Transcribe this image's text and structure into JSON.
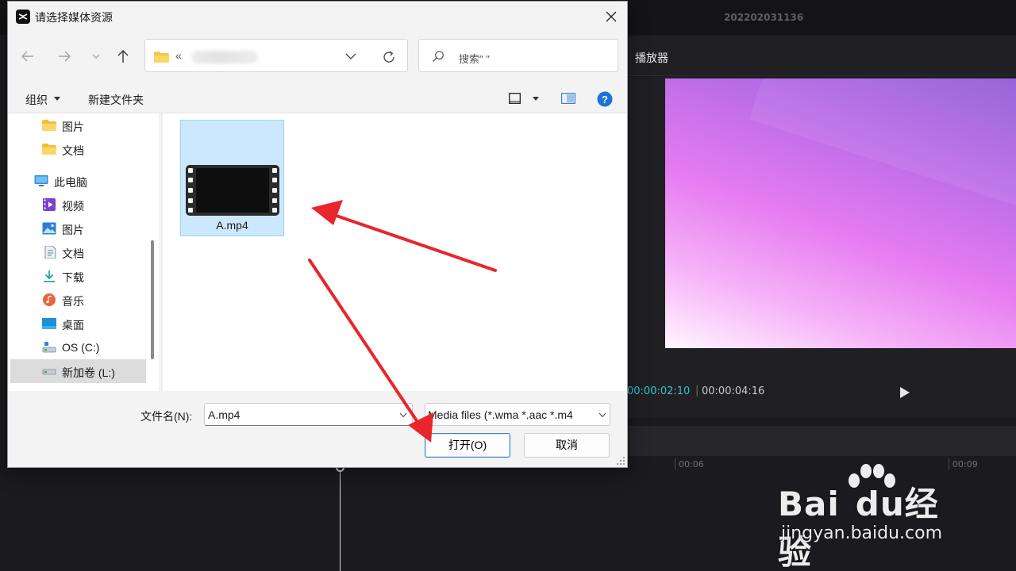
{
  "app": {
    "project_title": "202202031136",
    "player_label": "播放器",
    "time_current": "00:00:02:10",
    "time_separator": "|",
    "time_total": "00:00:04:16",
    "ruler": [
      {
        "label": "00:06"
      },
      {
        "label": "00:09"
      }
    ]
  },
  "dialog": {
    "title": "请选择媒体资源",
    "address_prefix": "«",
    "search_placeholder": "搜索\"  \"",
    "cmd_organize": "组织",
    "cmd_new_folder": "新建文件夹",
    "nav_items": [
      {
        "label": "图片",
        "icon": "folder-icon"
      },
      {
        "label": "文档",
        "icon": "folder-icon"
      },
      {
        "label": "此电脑",
        "icon": "computer-icon"
      },
      {
        "label": "视频",
        "icon": "video-library-icon"
      },
      {
        "label": "图片",
        "icon": "pictures-icon"
      },
      {
        "label": "文档",
        "icon": "documents-icon"
      },
      {
        "label": "下载",
        "icon": "download-icon"
      },
      {
        "label": "音乐",
        "icon": "music-icon"
      },
      {
        "label": "桌面",
        "icon": "desktop-icon"
      },
      {
        "label": "OS (C:)",
        "icon": "drive-icon"
      },
      {
        "label": "新加卷 (L:)",
        "icon": "drive-icon",
        "selected": true
      }
    ],
    "file": {
      "name": "A.mp4",
      "icon": "video-file-icon"
    },
    "filename_label": "文件名(N):",
    "filename_value": "A.mp4",
    "filetype_value": "Media files (*.wma *.aac *.m4",
    "open_label": "打开(O)",
    "cancel_label": "取消"
  },
  "watermark": {
    "logo_text_left": "Bai",
    "logo_text_mid": "du",
    "logo_text_right": "经验",
    "url": "jingyan.baidu.com"
  },
  "colors": {
    "accent": "#3a7bd5",
    "selection": "#cce8ff",
    "annotation_arrow": "#e8262b",
    "timecode": "#32c5d0"
  }
}
